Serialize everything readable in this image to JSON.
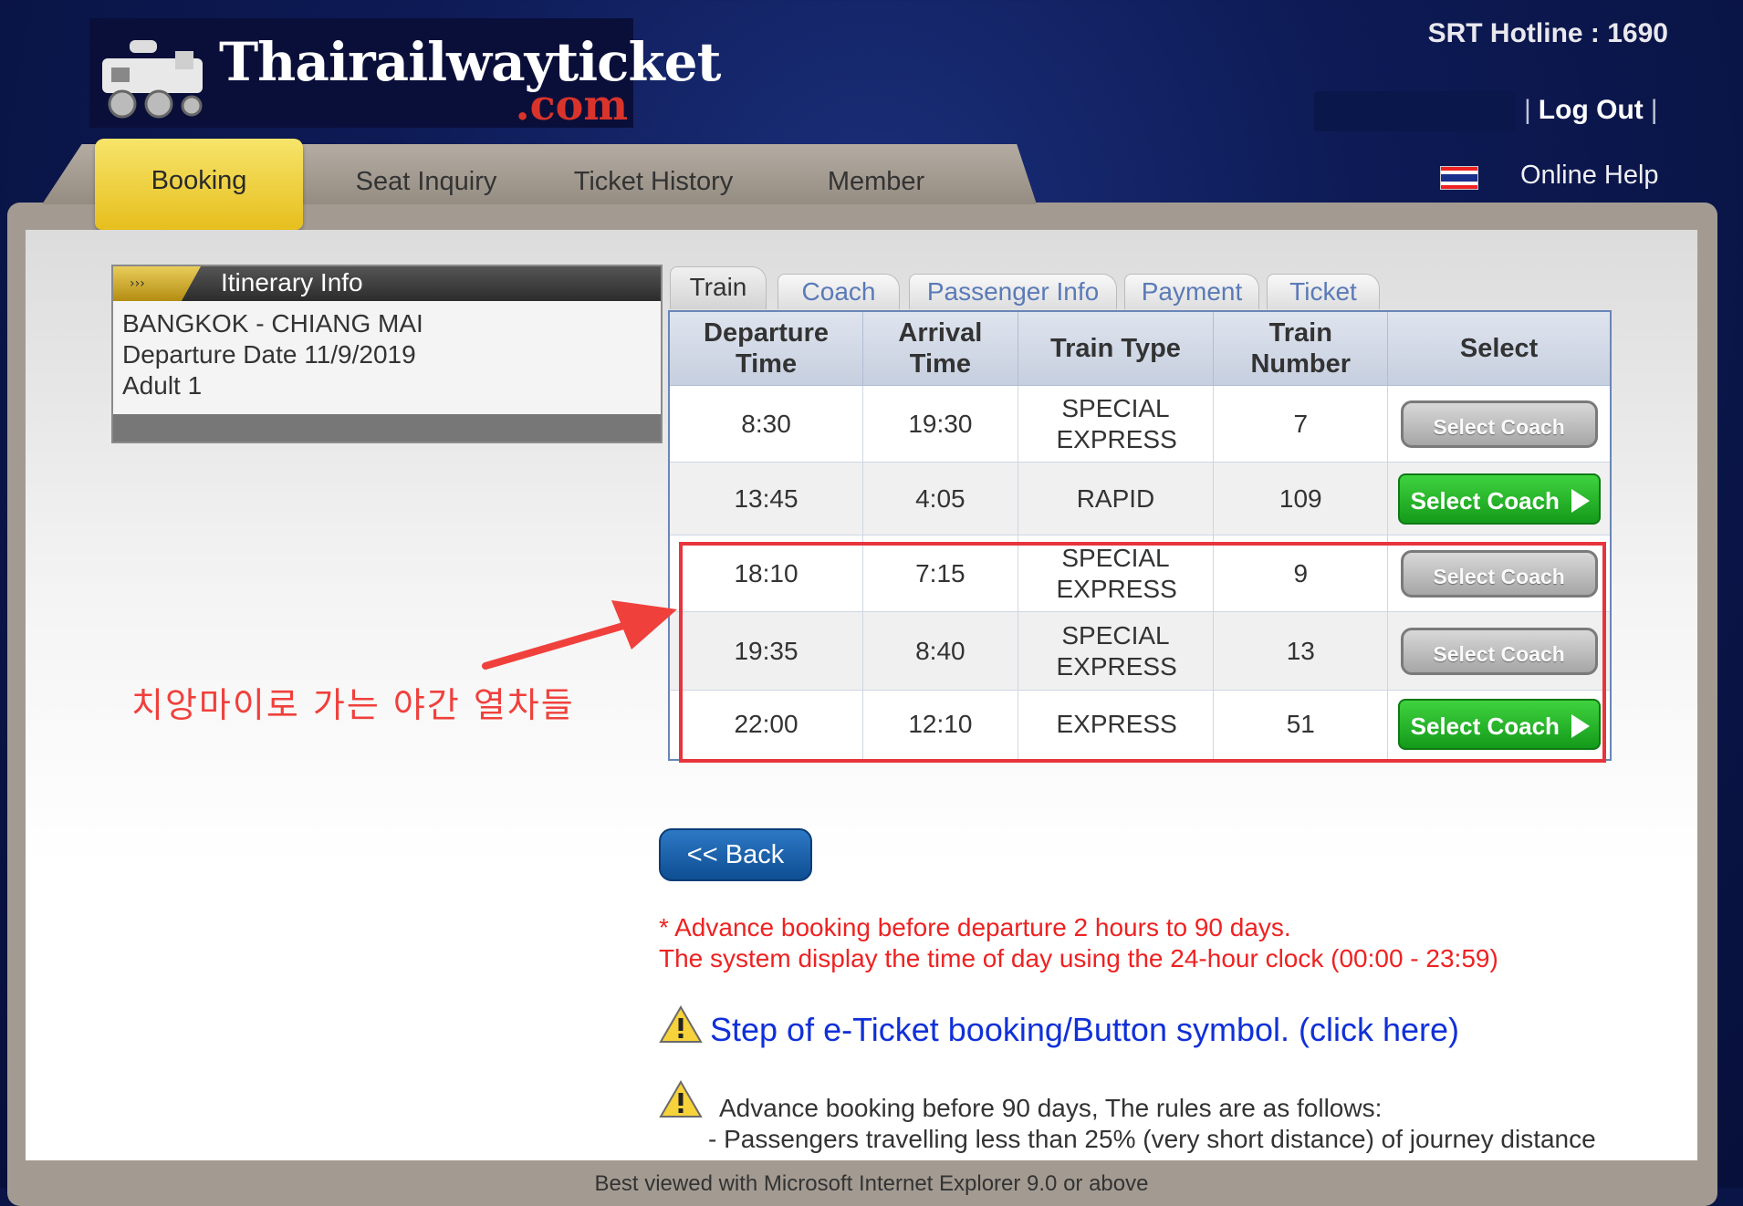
{
  "header": {
    "logo_main": "Thairailwayticket",
    "logo_suffix": ".com",
    "hotline": "SRT Hotline : 1690",
    "logout": "Log Out",
    "online_help": "Online Help"
  },
  "nav": {
    "items": [
      "Booking",
      "Seat Inquiry",
      "Ticket History",
      "Member"
    ],
    "active": "Booking"
  },
  "itinerary": {
    "title": "Itinerary Info",
    "route": "BANGKOK - CHIANG MAI",
    "departure": "Departure Date 11/9/2019",
    "passengers": "Adult 1"
  },
  "steps": [
    "Train",
    "Coach",
    "Passenger Info",
    "Payment",
    "Ticket"
  ],
  "table": {
    "headers": [
      "Departure Time",
      "Arrival Time",
      "Train Type",
      "Train Number",
      "Select"
    ],
    "rows": [
      {
        "dep": "8:30",
        "arr": "19:30",
        "type": "SPECIAL EXPRESS",
        "num": "7",
        "select": "Select Coach",
        "enabled": false
      },
      {
        "dep": "13:45",
        "arr": "4:05",
        "type": "RAPID",
        "num": "109",
        "select": "Select Coach",
        "enabled": true
      },
      {
        "dep": "18:10",
        "arr": "7:15",
        "type": "SPECIAL EXPRESS",
        "num": "9",
        "select": "Select Coach",
        "enabled": false
      },
      {
        "dep": "19:35",
        "arr": "8:40",
        "type": "SPECIAL EXPRESS",
        "num": "13",
        "select": "Select Coach",
        "enabled": false
      },
      {
        "dep": "22:00",
        "arr": "12:10",
        "type": "EXPRESS",
        "num": "51",
        "select": "Select Coach",
        "enabled": true
      }
    ]
  },
  "annotation": {
    "label": "치앙마이로 가는 야간 열차들",
    "color": "#f0403c"
  },
  "back_label": "<< Back",
  "notes": {
    "line1": "* Advance booking before departure 2 hours to 90 days.",
    "line2": "The system display the time of day using the 24-hour clock (00:00 - 23:59)"
  },
  "step_link": "Step of e-Ticket booking/Button symbol. (click here)",
  "rules": {
    "title": "Advance booking before 90 days, The rules are as follows:",
    "item1": "- Passengers travelling less than 25% (very short distance) of journey distance"
  },
  "footer": "Best viewed with Microsoft Internet Explorer 9.0 or above",
  "colors": {
    "accent_yellow": "#e6bf1e",
    "select_green": "#149a1a",
    "note_red": "#e22",
    "link_blue": "#1030d8"
  }
}
